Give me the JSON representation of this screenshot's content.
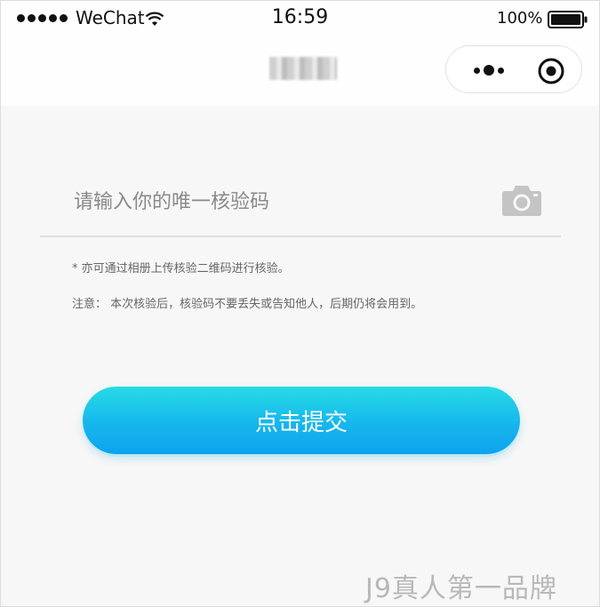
{
  "status_bar": {
    "carrier": "WeChat",
    "time": "16:59",
    "battery": "100%"
  },
  "nav": {
    "title": ""
  },
  "form": {
    "placeholder": "请输入你的唯一核验码",
    "hint_upload": "* 亦可通过相册上传核验二维码进行核验。",
    "hint_note": "注意： 本次核验后，核验码不要丢失或告知他人，后期仍将会用到。",
    "submit_label": "点击提交"
  },
  "watermark": "J9真人第一品牌",
  "colors": {
    "button_top": "#27dbe4",
    "button_bottom": "#0ea2ee",
    "background": "#f7f7f7"
  }
}
